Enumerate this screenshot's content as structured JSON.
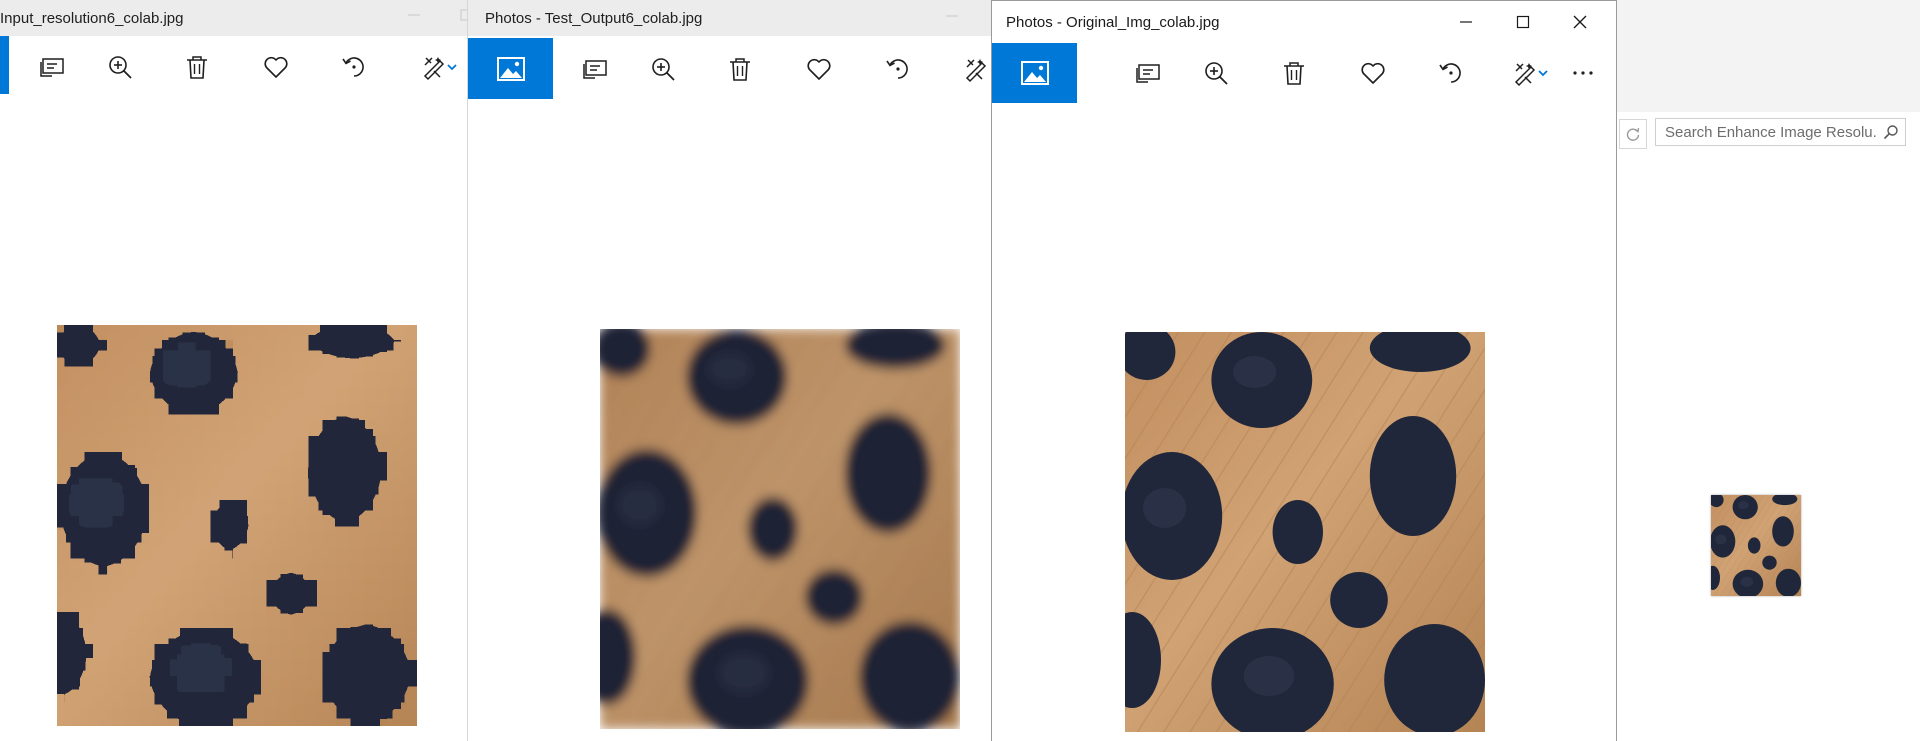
{
  "windows": [
    {
      "id": "win1",
      "title": "Input_resolution6_colab.jpg",
      "image_style": "pixelated"
    },
    {
      "id": "win2",
      "title": "Photos - Test_Output6_colab.jpg",
      "image_style": "blurry"
    },
    {
      "id": "win3",
      "title": "Photos - Original_Img_colab.jpg",
      "image_style": "sharp"
    }
  ],
  "toolbar": {
    "icons": [
      "photos-home-icon",
      "slideshow-icon",
      "zoom-in-icon",
      "trash-icon",
      "heart-icon",
      "rotate-icon",
      "edit-create-icon",
      "chevron-down-icon",
      "more-icon"
    ]
  },
  "window_controls": [
    "minimize-icon",
    "maximize-icon",
    "close-icon"
  ],
  "explorer": {
    "search_placeholder": "Search Enhance Image Resolu...",
    "thumbnail_name": "Original_Img_colab.jpg"
  },
  "colors": {
    "accent": "#0078d7",
    "titlebar_inactive": "#ececec",
    "icon": "#1f1f1f",
    "fur_light": "#c99a6a",
    "fur_dark": "#a8784c",
    "spot": "#202636"
  }
}
